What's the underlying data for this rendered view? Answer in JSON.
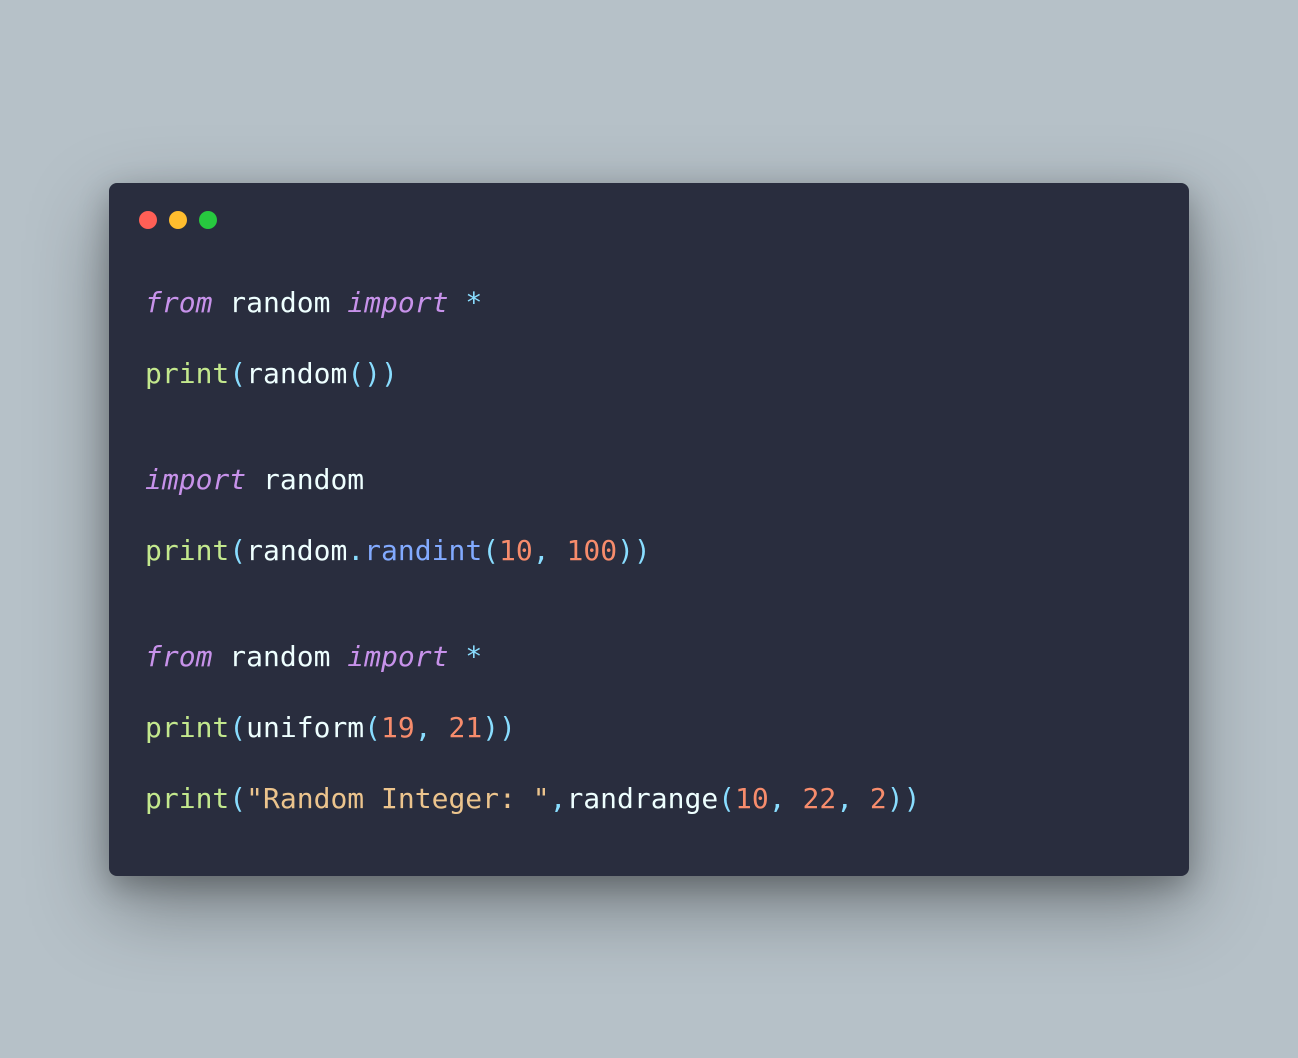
{
  "window": {
    "trafficLights": [
      "red",
      "yellow",
      "green"
    ]
  },
  "code": {
    "lines": [
      {
        "tokens": [
          {
            "cls": "tok-kw",
            "text": "from"
          },
          {
            "cls": "tok-ident",
            "text": " random "
          },
          {
            "cls": "tok-kw",
            "text": "import"
          },
          {
            "cls": "tok-ident",
            "text": " "
          },
          {
            "cls": "tok-star",
            "text": "*"
          }
        ]
      },
      {
        "tokens": [
          {
            "cls": "tok-print",
            "text": "print"
          },
          {
            "cls": "tok-punct",
            "text": "("
          },
          {
            "cls": "tok-ident",
            "text": "random"
          },
          {
            "cls": "tok-punct",
            "text": "())"
          }
        ]
      },
      {
        "blank": true
      },
      {
        "tokens": [
          {
            "cls": "tok-kw",
            "text": "import"
          },
          {
            "cls": "tok-ident",
            "text": " random"
          }
        ]
      },
      {
        "tokens": [
          {
            "cls": "tok-print",
            "text": "print"
          },
          {
            "cls": "tok-punct",
            "text": "("
          },
          {
            "cls": "tok-ident",
            "text": "random"
          },
          {
            "cls": "tok-dot",
            "text": "."
          },
          {
            "cls": "tok-func",
            "text": "randint"
          },
          {
            "cls": "tok-punct",
            "text": "("
          },
          {
            "cls": "tok-num",
            "text": "10"
          },
          {
            "cls": "tok-comma",
            "text": ", "
          },
          {
            "cls": "tok-num",
            "text": "100"
          },
          {
            "cls": "tok-punct",
            "text": "))"
          }
        ]
      },
      {
        "blank": true
      },
      {
        "tokens": [
          {
            "cls": "tok-kw",
            "text": "from"
          },
          {
            "cls": "tok-ident",
            "text": " random "
          },
          {
            "cls": "tok-kw",
            "text": "import"
          },
          {
            "cls": "tok-ident",
            "text": " "
          },
          {
            "cls": "tok-star",
            "text": "*"
          }
        ]
      },
      {
        "tokens": [
          {
            "cls": "tok-print",
            "text": "print"
          },
          {
            "cls": "tok-punct",
            "text": "("
          },
          {
            "cls": "tok-ident",
            "text": "uniform"
          },
          {
            "cls": "tok-punct",
            "text": "("
          },
          {
            "cls": "tok-num",
            "text": "19"
          },
          {
            "cls": "tok-comma",
            "text": ", "
          },
          {
            "cls": "tok-num",
            "text": "21"
          },
          {
            "cls": "tok-punct",
            "text": "))"
          }
        ]
      },
      {
        "tokens": [
          {
            "cls": "tok-print",
            "text": "print"
          },
          {
            "cls": "tok-punct",
            "text": "("
          },
          {
            "cls": "tok-str",
            "text": "\"Random Integer: \""
          },
          {
            "cls": "tok-comma",
            "text": ","
          },
          {
            "cls": "tok-ident",
            "text": "randrange"
          },
          {
            "cls": "tok-punct",
            "text": "("
          },
          {
            "cls": "tok-num",
            "text": "10"
          },
          {
            "cls": "tok-comma",
            "text": ", "
          },
          {
            "cls": "tok-num",
            "text": "22"
          },
          {
            "cls": "tok-comma",
            "text": ", "
          },
          {
            "cls": "tok-num",
            "text": "2"
          },
          {
            "cls": "tok-punct",
            "text": "))"
          }
        ]
      }
    ]
  }
}
